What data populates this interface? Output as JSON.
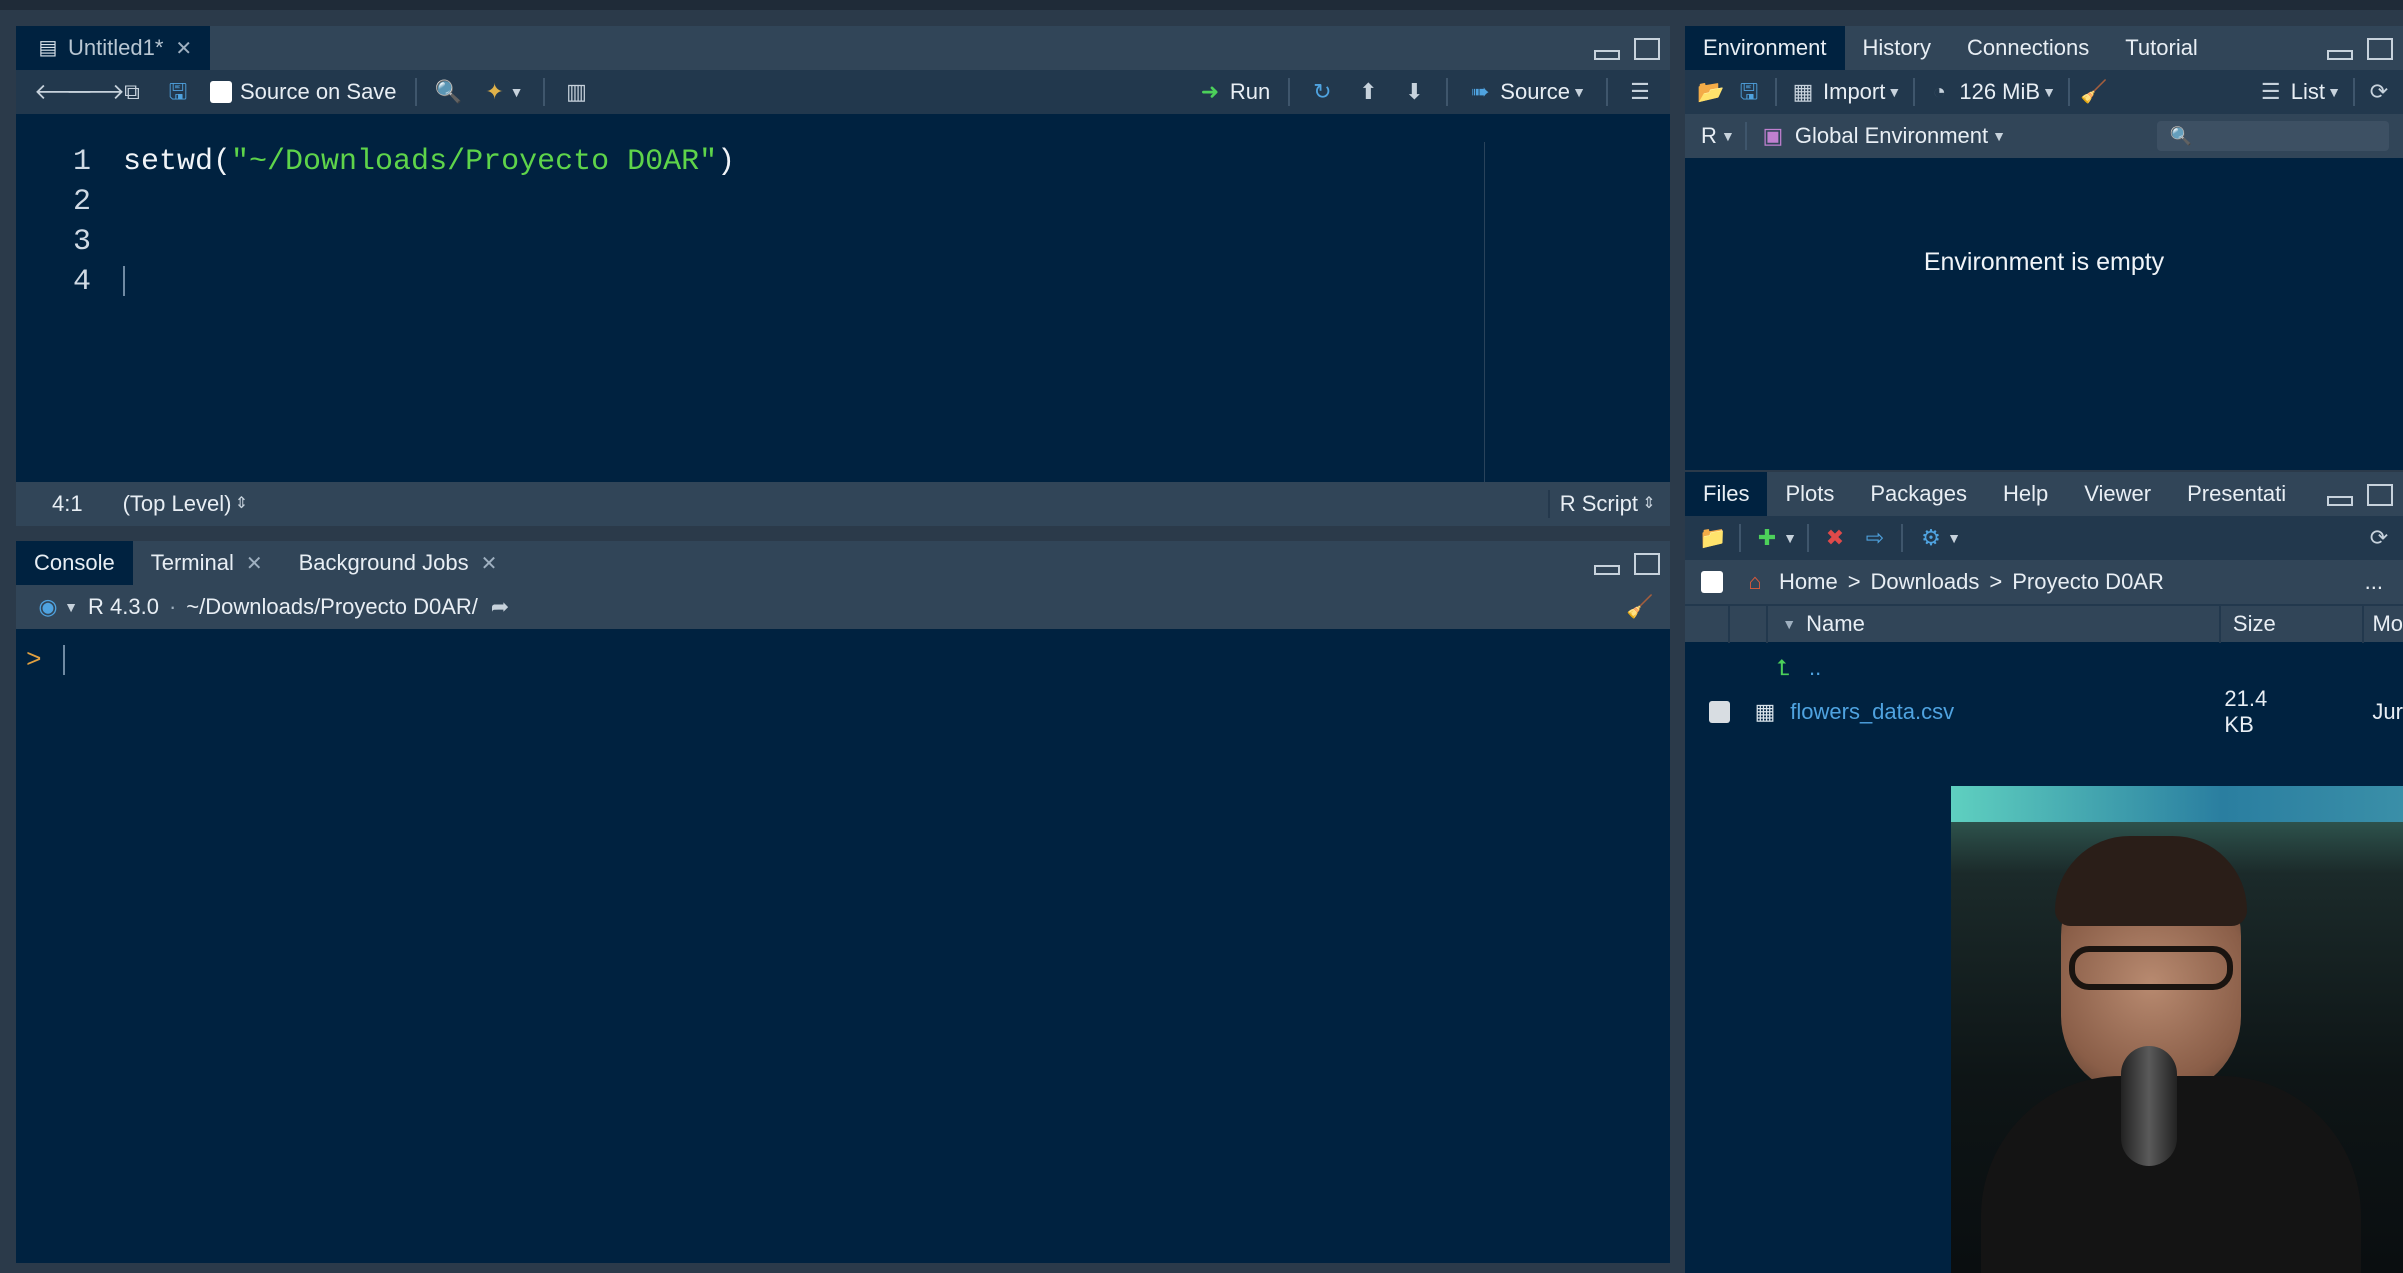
{
  "source_pane": {
    "tab_label": "Untitled1*",
    "source_on_save": "Source on Save",
    "run": "Run",
    "source": "Source",
    "code": {
      "line_numbers": [
        "1",
        "2",
        "3",
        "4"
      ],
      "func": "setwd(",
      "string": "\"~/Downloads/Proyecto D0AR\"",
      "close": ")"
    },
    "status": {
      "position": "4:1",
      "scope": "(Top Level)",
      "file_type": "R Script"
    }
  },
  "console_pane": {
    "tabs": {
      "console": "Console",
      "terminal": "Terminal",
      "jobs": "Background Jobs"
    },
    "r_version": "R 4.3.0",
    "separator": "·",
    "path": "~/Downloads/Proyecto D0AR/",
    "prompt": ">"
  },
  "env_pane": {
    "tabs": {
      "environment": "Environment",
      "history": "History",
      "connections": "Connections",
      "tutorial": "Tutorial"
    },
    "import": "Import",
    "memory": "126 MiB",
    "list": "List",
    "language": "R",
    "global_env": "Global Environment",
    "empty_message": "Environment is empty"
  },
  "files_pane": {
    "tabs": {
      "files": "Files",
      "plots": "Plots",
      "packages": "Packages",
      "help": "Help",
      "viewer": "Viewer",
      "presentation": "Presentati"
    },
    "breadcrumb": {
      "home": "Home",
      "sep": ">",
      "downloads": "Downloads",
      "folder": "Proyecto D0AR",
      "more": "..."
    },
    "columns": {
      "name": "Name",
      "size": "Size",
      "modified": "Mo"
    },
    "parent": "..",
    "file": {
      "name": "flowers_data.csv",
      "size": "21.4 KB",
      "modified": "Jur"
    }
  },
  "colors": {
    "pane_bg": "#002240",
    "tab_bg": "#314558",
    "string_green": "#5ed44a",
    "link_blue": "#4fa3e0"
  }
}
